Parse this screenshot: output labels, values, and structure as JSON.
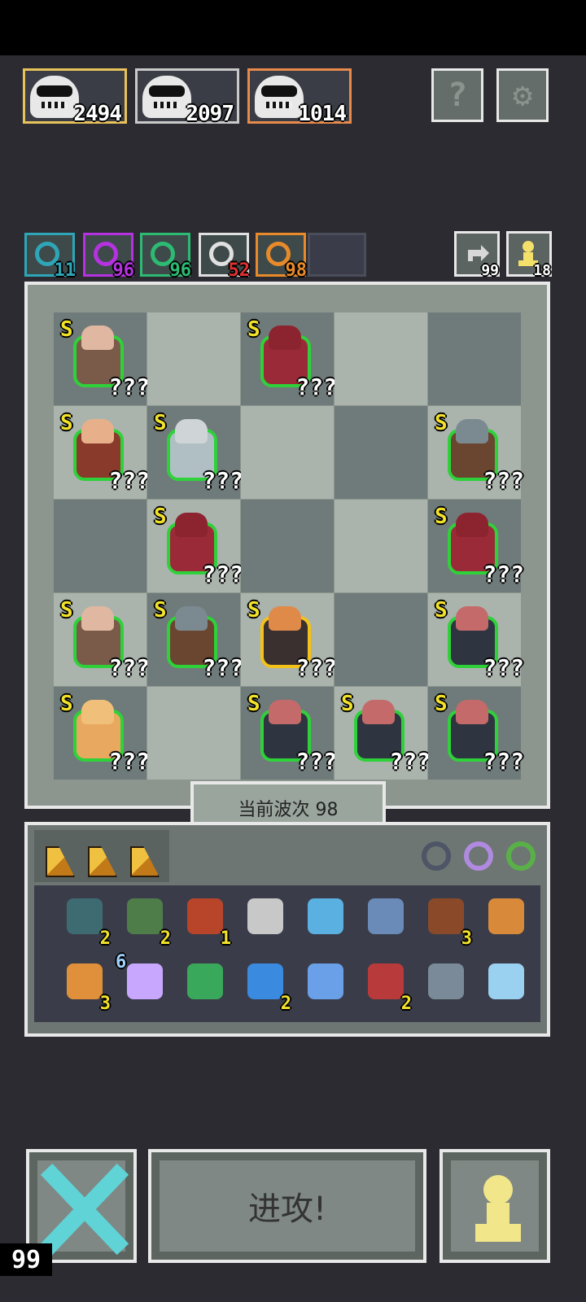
{
  "bosses": [
    {
      "hp": "2494",
      "border": "#e8c25a"
    },
    {
      "hp": "2097",
      "border": "#c9c9c9"
    },
    {
      "hp": "1014",
      "border": "#e88a4a"
    }
  ],
  "top_buttons": [
    {
      "icon": "help-icon",
      "glyph": "?"
    },
    {
      "icon": "gear-icon",
      "glyph": "⚙"
    }
  ],
  "stats": [
    {
      "icon": "spiral-icon",
      "value": "11",
      "color": "#2ea6b8"
    },
    {
      "icon": "swirl-icon",
      "value": "96",
      "color": "#b532e0"
    },
    {
      "icon": "eye-icon",
      "value": "96",
      "color": "#2dbb73"
    },
    {
      "icon": "bulb-icon",
      "value": "52",
      "color": "#e0e0e0"
    },
    {
      "icon": "pulse-icon",
      "value": "98",
      "color": "#e88a2a"
    }
  ],
  "resources": [
    {
      "icon": "refresh-icon",
      "value": "99"
    },
    {
      "icon": "pawn-icon",
      "value": "18"
    }
  ],
  "board": {
    "rank_label": "S",
    "unknown_label": "???",
    "units": [
      {
        "row": 0,
        "col": 0,
        "type": "old-man",
        "head": "#e0b7a0",
        "body": "#7a5a48"
      },
      {
        "row": 0,
        "col": 2,
        "type": "red-mage",
        "head": "#8c2430",
        "body": "#9b2a38"
      },
      {
        "row": 1,
        "col": 0,
        "type": "hunter",
        "head": "#e8b08a",
        "body": "#8a3a2a"
      },
      {
        "row": 1,
        "col": 1,
        "type": "silver-girl",
        "head": "#cfd4d6",
        "body": "#b0bfc4"
      },
      {
        "row": 1,
        "col": 4,
        "type": "shield-knight",
        "head": "#7b8a90",
        "body": "#6a4530"
      },
      {
        "row": 2,
        "col": 1,
        "type": "red-mage",
        "head": "#8c2430",
        "body": "#9b2a38"
      },
      {
        "row": 2,
        "col": 4,
        "type": "red-mage",
        "head": "#8c2430",
        "body": "#9b2a38"
      },
      {
        "row": 3,
        "col": 0,
        "type": "old-man",
        "head": "#e0b7a0",
        "body": "#7a5a48"
      },
      {
        "row": 3,
        "col": 1,
        "type": "shield-knight",
        "head": "#7b8a90",
        "body": "#6a4530"
      },
      {
        "row": 3,
        "col": 2,
        "type": "viking",
        "head": "#e08a4a",
        "body": "#3a3030",
        "gold": true
      },
      {
        "row": 3,
        "col": 4,
        "type": "dwarf",
        "head": "#c46a6a",
        "body": "#2e3440"
      },
      {
        "row": 4,
        "col": 0,
        "type": "golem",
        "head": "#f0c07a",
        "body": "#e8a860"
      },
      {
        "row": 4,
        "col": 2,
        "type": "dwarf",
        "head": "#c46a6a",
        "body": "#2e3440"
      },
      {
        "row": 4,
        "col": 3,
        "type": "dwarf",
        "head": "#c46a6a",
        "body": "#2e3440"
      },
      {
        "row": 4,
        "col": 4,
        "type": "dwarf",
        "head": "#c46a6a",
        "body": "#2e3440"
      }
    ]
  },
  "wave_label": "当前波次 98",
  "inventory": {
    "wedges": 3,
    "orbs": [
      {
        "icon": "cauldron-icon",
        "color": "#4d5566"
      },
      {
        "icon": "ring-purple-icon",
        "color": "#b08ae0"
      },
      {
        "icon": "ring-green-icon",
        "color": "#5ab048"
      }
    ],
    "row1": [
      {
        "icon": "heart-shield-icon",
        "count": "2",
        "color": "#3e6a72"
      },
      {
        "icon": "goblin-icon",
        "count": "2",
        "color": "#4f7d4a"
      },
      {
        "icon": "bomb-icon",
        "count": "1",
        "color": "#b8442a"
      },
      {
        "icon": "potion-icon",
        "count": "",
        "color": "#c8c8c8"
      },
      {
        "icon": "molecule-icon",
        "count": "",
        "color": "#5ab0e0"
      },
      {
        "icon": "basket-icon",
        "count": "",
        "color": "#6a8ab8"
      },
      {
        "icon": "book-icon",
        "count": "3",
        "color": "#8a4a2a"
      },
      {
        "icon": "star-wand-icon",
        "count": "",
        "color": "#d88a3a"
      }
    ],
    "row2": [
      {
        "icon": "bust-icon",
        "count": "3",
        "color": "#e0903a",
        "level": ""
      },
      {
        "icon": "sparkle-icon",
        "count": "",
        "color": "#c8a8ff",
        "level": "6"
      },
      {
        "icon": "recycle-bin-icon",
        "count": "",
        "color": "#3aa85a",
        "level": ""
      },
      {
        "icon": "water-drop-icon",
        "count": "2",
        "color": "#3a8ae0",
        "level": ""
      },
      {
        "icon": "armor-icon",
        "count": "",
        "color": "#6aa0e8",
        "level": ""
      },
      {
        "icon": "mouth-icon",
        "count": "2",
        "color": "#b83a3a",
        "level": ""
      },
      {
        "icon": "spiked-shell-icon",
        "count": "",
        "color": "#7a8a98",
        "level": ""
      },
      {
        "icon": "ice-blade-icon",
        "count": "",
        "color": "#9ad0f0",
        "level": ""
      }
    ]
  },
  "bottom": {
    "cancel_icon": "cross-icon",
    "attack_label": "进攻!",
    "pawn_icon": "pawn-icon",
    "counter": "99"
  }
}
